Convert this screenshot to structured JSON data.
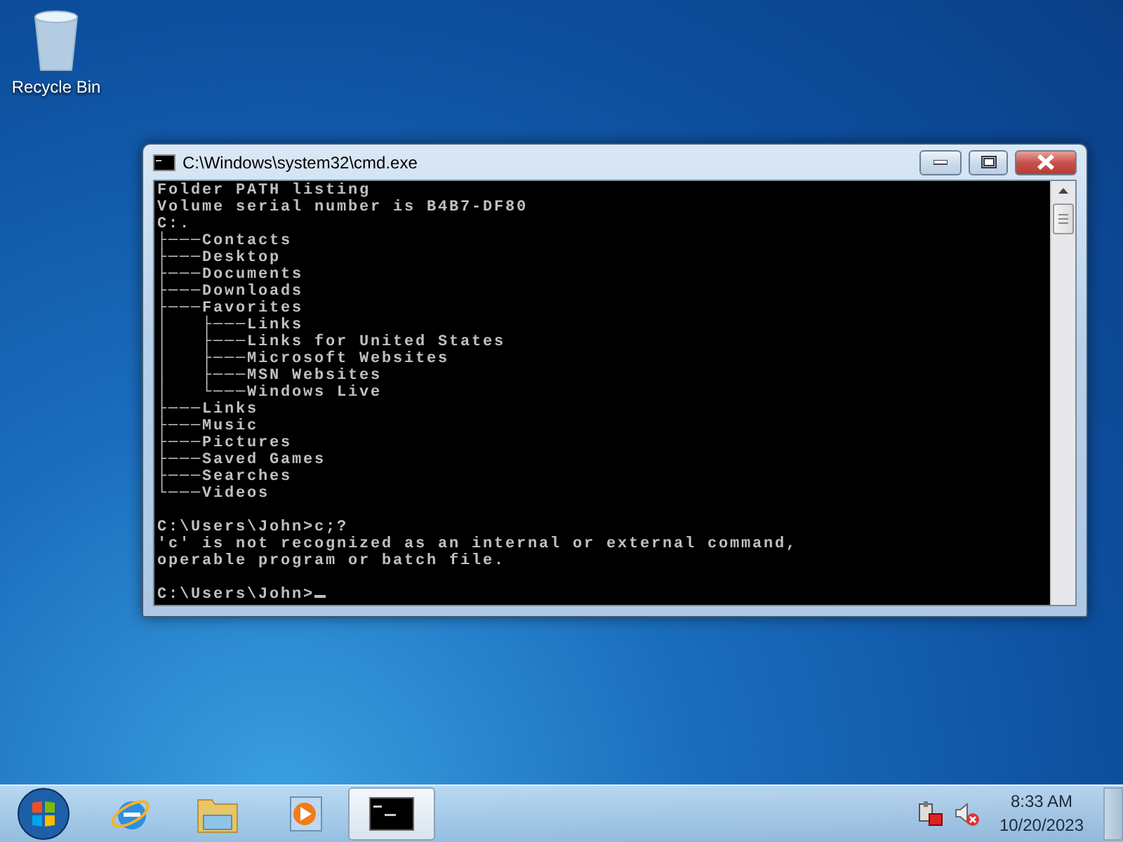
{
  "desktop_icons": [
    {
      "label": "Recycle Bin"
    }
  ],
  "window": {
    "title": "C:\\Windows\\system32\\cmd.exe",
    "active": true,
    "console": {
      "blocks": [
        [
          "Folder PATH listing",
          "Volume serial number is B4B7-DF80",
          "C:.",
          "├───Contacts",
          "├───Desktop",
          "├───Documents",
          "├───Downloads",
          "├───Favorites",
          "│   ├───Links",
          "│   ├───Links for United States",
          "│   ├───Microsoft Websites",
          "│   ├───MSN Websites",
          "│   └───Windows Live",
          "├───Links",
          "├───Music",
          "├───Pictures",
          "├───Saved Games",
          "├───Searches",
          "└───Videos"
        ],
        [
          "C:\\Users\\John>c;?",
          "'c' is not recognized as an internal or external command,",
          "operable program or batch file."
        ],
        [
          "C:\\Users\\John>"
        ]
      ],
      "cursor": true
    }
  },
  "taskbar": {
    "items": [
      {
        "kind": "start",
        "selected": false
      },
      {
        "kind": "browser",
        "selected": false
      },
      {
        "kind": "folder",
        "selected": false
      },
      {
        "kind": "media",
        "selected": false
      },
      {
        "kind": "console",
        "selected": true
      }
    ],
    "tray": {
      "network_error": true,
      "muted": true,
      "time": "8:33 AM",
      "date": "10/20/2023"
    }
  }
}
